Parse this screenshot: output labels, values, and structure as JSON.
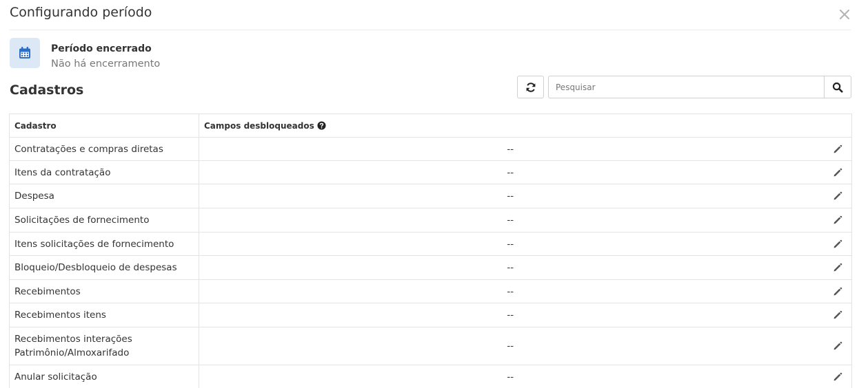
{
  "modal": {
    "title": "Configurando período"
  },
  "period": {
    "title": "Período encerrado",
    "subtitle": "Não há encerramento"
  },
  "section": {
    "title": "Cadastros"
  },
  "search": {
    "placeholder": "Pesquisar",
    "value": ""
  },
  "table": {
    "headers": {
      "cadastro": "Cadastro",
      "campos": "Campos desbloqueados"
    },
    "rows": [
      {
        "name": "Contratações e compras diretas",
        "fields": "--"
      },
      {
        "name": "Itens da contratação",
        "fields": "--"
      },
      {
        "name": "Despesa",
        "fields": "--"
      },
      {
        "name": "Solicitações de fornecimento",
        "fields": "--"
      },
      {
        "name": "Itens solicitações de fornecimento",
        "fields": "--"
      },
      {
        "name": "Bloqueio/Desbloqueio de despesas",
        "fields": "--"
      },
      {
        "name": "Recebimentos",
        "fields": "--"
      },
      {
        "name": "Recebimentos itens",
        "fields": "--"
      },
      {
        "name": "Recebimentos interações Patrimônio/Almoxarifado",
        "fields": "--"
      },
      {
        "name": "Anular solicitação",
        "fields": "--"
      }
    ]
  },
  "colors": {
    "accent": "#2a6fc9",
    "icon_bg": "#dde8f6",
    "border": "#e3e3e3"
  },
  "icons": {
    "close": "close-icon",
    "period": "calendar-icon",
    "refresh": "refresh-icon",
    "search": "search-icon",
    "help": "question-circle-icon",
    "edit": "pencil-icon"
  }
}
